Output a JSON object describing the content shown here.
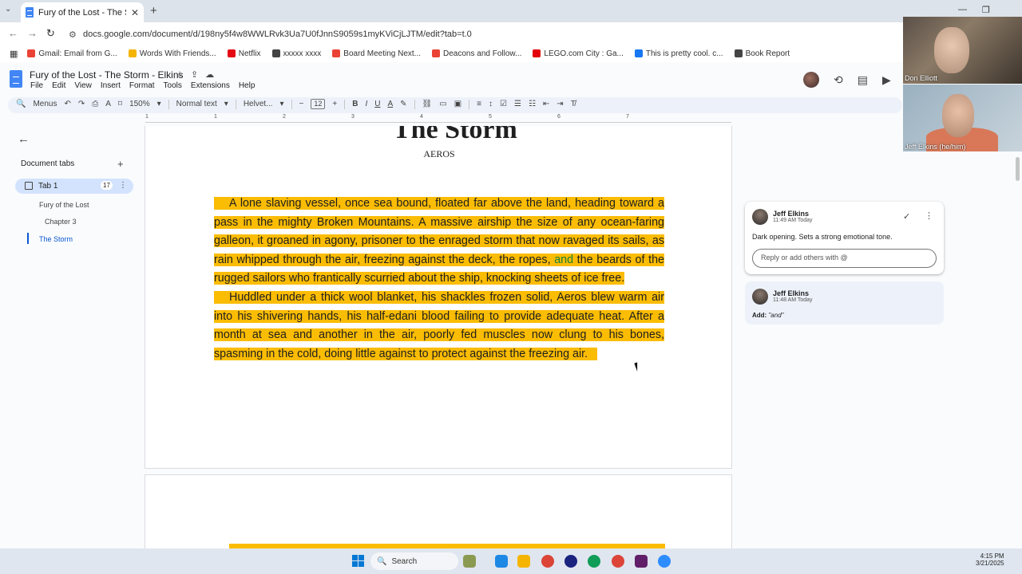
{
  "browser": {
    "tab_title": "Fury of the Lost - The Storm - E",
    "url": "docs.google.com/document/d/198ny5f4w8WWLRvk3Ua7U0fJnnS9059s1myKViCjLJTM/edit?tab=t.0",
    "bookmarks": [
      {
        "label": "Gmail: Email from G...",
        "color": "#ea4335"
      },
      {
        "label": "Words With Friends...",
        "color": "#f4b400"
      },
      {
        "label": "Netflix",
        "color": "#e50914"
      },
      {
        "label": "xxxxx xxxx",
        "color": "#444444"
      },
      {
        "label": "Board Meeting Next...",
        "color": "#ea4335"
      },
      {
        "label": "Deacons and Follow...",
        "color": "#ea4335"
      },
      {
        "label": "LEGO.com City : Ga...",
        "color": "#e3000b"
      },
      {
        "label": "This is pretty cool. c...",
        "color": "#1877f2"
      },
      {
        "label": "Book Report",
        "color": "#444444"
      }
    ]
  },
  "docs": {
    "title": "Fury of the Lost - The Storm - Elkins",
    "menu": [
      "File",
      "Edit",
      "View",
      "Insert",
      "Format",
      "Tools",
      "Extensions",
      "Help"
    ],
    "toolbar": {
      "menus": "Menus",
      "zoom": "150%",
      "style": "Normal text",
      "font": "Helvet...",
      "font_size": "12"
    },
    "ruler_numbers": [
      "1",
      "1",
      "2",
      "3",
      "4",
      "5",
      "6",
      "7"
    ]
  },
  "sidebar": {
    "tabs_label": "Document tabs",
    "tab1_label": "Tab 1",
    "tab1_badge": "17",
    "outline": [
      "Fury of the Lost",
      "Chapter 3",
      "The Storm"
    ]
  },
  "document": {
    "heading": "The Storm",
    "subheading": "AEROS",
    "p1_before": "A lone sl",
    "p1_main": "aving vessel, once sea bound, floated far above the land, heading toward a pass in the mighty Broken Mountains. A massive airship the size of any ocean-faring galleon, it groaned in agony, prisoner to the enraged storm that now ravaged its sails, as rain whipped through the air, freezing against the deck, the ropes, ",
    "p1_insert": "and",
    "p1_after": " the beards of the rugged sailors who frantically scurried about the ship, knocking sheets of ice free.",
    "p2": "Huddled under a thick wool blanket, his shackles frozen solid, Aeros blew warm air into his shivering hands, his half-edani blood failing to provide adequate heat. After a month at sea and another in the air, poorly fed muscles now clung to his bones, spasming in the cold, doing little against to protect against the freezing air."
  },
  "comments": [
    {
      "author": "Jeff Elkins",
      "time": "11:49 AM Today",
      "text": "Dark opening. Sets a strong emotional tone.",
      "reply_placeholder": "Reply or add others with @"
    },
    {
      "author": "Jeff Elkins",
      "time": "11:48 AM Today",
      "add_label": "Add:",
      "add_value": "\"and\""
    }
  ],
  "video": {
    "participant1": "Don Elliott",
    "participant2": "Jeff Elkins (he/him)"
  },
  "taskbar": {
    "search": "Search",
    "time": "4:15 PM",
    "date": "3/21/2025"
  },
  "colors": {
    "highlight": "#fbbc04",
    "accent": "#0b57d0",
    "suggestion_insert": "#188038"
  }
}
